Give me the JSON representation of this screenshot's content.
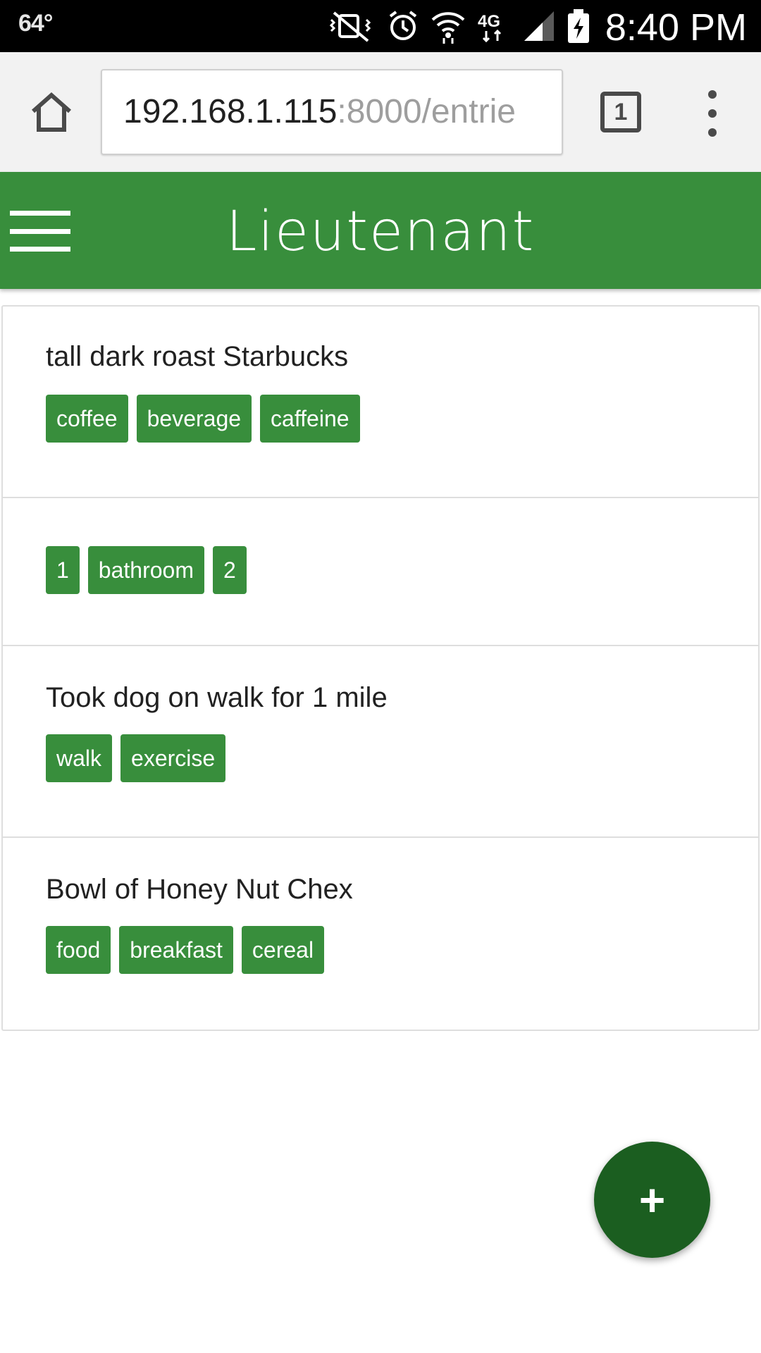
{
  "status_bar": {
    "temperature": "64°",
    "network": "4G",
    "time": "8:40 PM"
  },
  "browser": {
    "url_host": "192.168.1.115",
    "url_path": ":8000/entrie",
    "tab_count": "1"
  },
  "app": {
    "title": "Lieutenant",
    "accent_color": "#388e3c",
    "fab_color": "#1b5e20"
  },
  "entries": [
    {
      "title": "tall dark roast Starbucks",
      "tags": [
        "coffee",
        "beverage",
        "caffeine"
      ]
    },
    {
      "title": "",
      "tags": [
        "1",
        "bathroom",
        "2"
      ]
    },
    {
      "title": "Took dog on walk for 1 mile",
      "tags": [
        "walk",
        "exercise"
      ]
    },
    {
      "title": "Bowl of Honey Nut Chex",
      "tags": [
        "food",
        "breakfast",
        "cereal"
      ]
    }
  ],
  "fab": {
    "label": "+"
  }
}
